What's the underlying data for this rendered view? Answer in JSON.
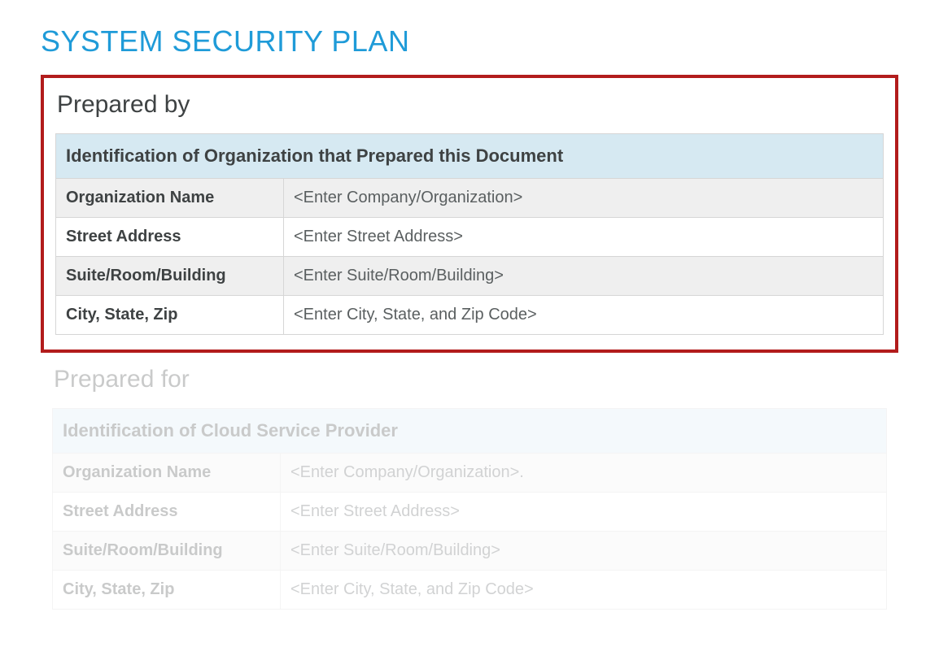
{
  "title": "SYSTEM SECURITY PLAN",
  "prepared_by": {
    "heading": "Prepared by",
    "table_title": "Identification of Organization that Prepared this Document",
    "rows": [
      {
        "label": "Organization Name",
        "value": "<Enter Company/Organization>"
      },
      {
        "label": "Street Address",
        "value": "<Enter Street Address>"
      },
      {
        "label": "Suite/Room/Building",
        "value": "<Enter Suite/Room/Building>"
      },
      {
        "label": "City, State, Zip",
        "value": "<Enter City, State, and Zip Code>"
      }
    ]
  },
  "prepared_for": {
    "heading": "Prepared for",
    "table_title": "Identification of Cloud Service Provider",
    "rows": [
      {
        "label": "Organization Name",
        "value": "<Enter Company/Organization>."
      },
      {
        "label": "Street Address",
        "value": "<Enter Street Address>"
      },
      {
        "label": "Suite/Room/Building",
        "value": "<Enter Suite/Room/Building>"
      },
      {
        "label": "City, State, Zip",
        "value": "<Enter City, State, and Zip Code>"
      }
    ]
  }
}
